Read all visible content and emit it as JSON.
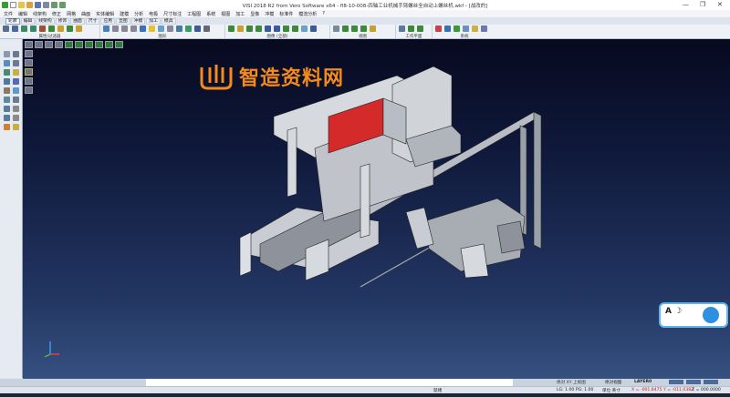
{
  "window": {
    "title": "VISI 2018 R2 from Vero Software x64 - fl8-10-008-四轴工业机械手臂螺丝全自动上螺丝机.wkf - [战改的]",
    "minimize": "—",
    "maximize": "❐",
    "close": "✕"
  },
  "menu": [
    "文件",
    "编辑",
    "线架构",
    "修正",
    "网格",
    "曲面",
    "实体编辑",
    "建模",
    "分析",
    "电极",
    "尺寸标注",
    "工程图",
    "系统",
    "视图",
    "加工",
    "显像",
    "冲模",
    "标准件",
    "模流分析",
    "?"
  ],
  "tabs": [
    "轮廓",
    "编辑",
    "线架构",
    "修饰",
    "曲面",
    "尺寸",
    "应用",
    "显图",
    "冲模",
    "加工",
    "模具"
  ],
  "active_tab": "轮廓",
  "ribbon_groups": [
    "属性/过滤器",
    "图形",
    "图像 (全部)",
    "视图",
    "工作平面",
    "系统"
  ],
  "watermark": {
    "text": "智造资料网",
    "color": "#f28a1e"
  },
  "status": {
    "view": "绝对 XY 上视图",
    "abs_view": "绝对视图",
    "layer": "LAYER0",
    "mode": "就绪",
    "lg_pg": "LG: 1.00 PG: 1.00",
    "unit": "单位 英寸",
    "coords": "X = -001.8475 Y = -011.0382",
    "z": "Z = 000.0000"
  },
  "colors": {
    "viewport_top": "#07091f",
    "viewport_bottom": "#355080",
    "coords": "#d0201c",
    "model": "#c9ccd2",
    "highlight": "#d42a2a"
  }
}
